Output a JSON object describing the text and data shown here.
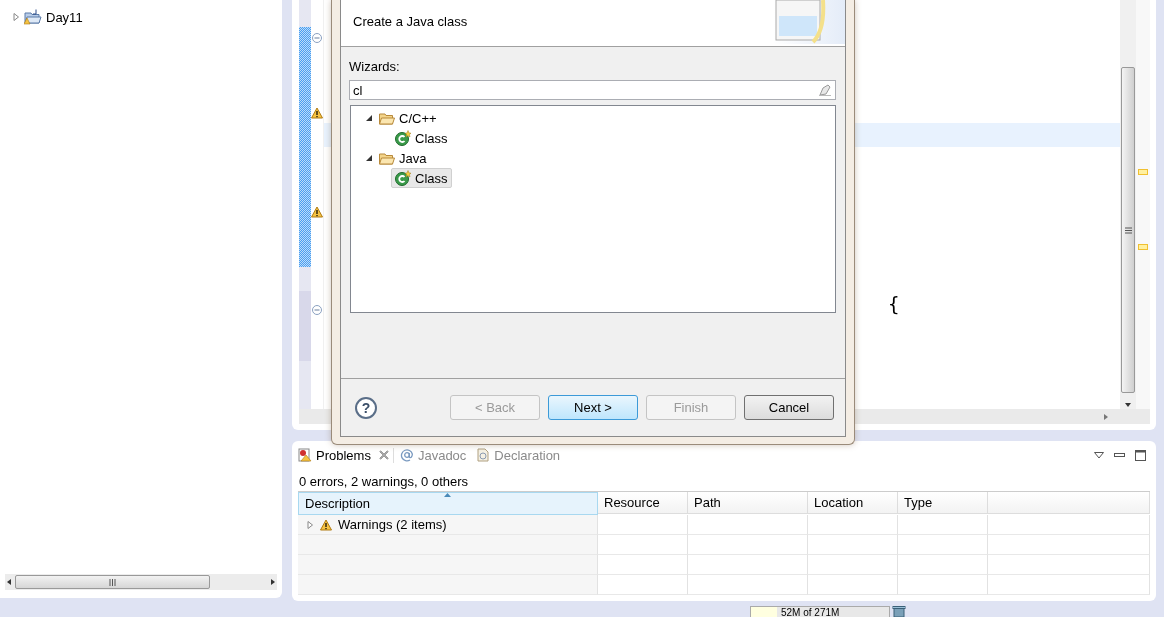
{
  "project_tree": {
    "items": [
      {
        "label": "Day11",
        "expanded": false
      }
    ]
  },
  "editor": {
    "text": "{"
  },
  "dialog": {
    "description": "Create a Java class",
    "filter_label": "Wizards:",
    "filter": {
      "value": "cl"
    },
    "wizards": [
      {
        "label": "C/C++",
        "expanded": true,
        "children": [
          {
            "label": "Class",
            "selected": false
          }
        ]
      },
      {
        "label": "Java",
        "expanded": true,
        "children": [
          {
            "label": "Class",
            "selected": true
          }
        ]
      }
    ],
    "help": "?",
    "buttons": [
      {
        "label": "< Back",
        "disabled": true,
        "default": false
      },
      {
        "label": "Next >",
        "disabled": false,
        "default": true
      },
      {
        "label": "Finish",
        "disabled": true,
        "default": false
      },
      {
        "label": "Cancel",
        "disabled": false,
        "default": false
      }
    ]
  },
  "problems": {
    "tabs": [
      {
        "label": "Problems",
        "selected": true
      },
      {
        "label": "Javadoc",
        "selected": false
      },
      {
        "label": "Declaration",
        "selected": false
      }
    ],
    "summary": "0 errors, 2 warnings, 0 others",
    "columns": [
      "Description",
      "Resource",
      "Path",
      "Location",
      "Type"
    ],
    "rows": [
      {
        "label": "Warnings (2 items)",
        "expanded": false
      }
    ]
  },
  "status_bar": {
    "memory": "52M of 271M"
  }
}
